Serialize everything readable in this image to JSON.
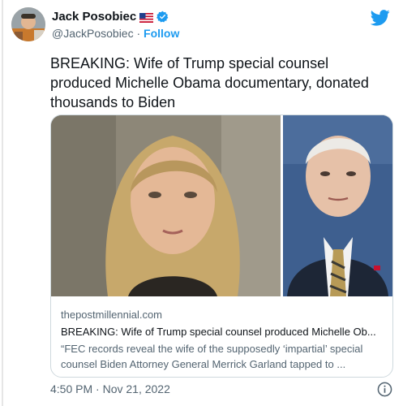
{
  "author": {
    "name": "Jack Posobiec",
    "handle": "@JackPosobiec",
    "separator": "·",
    "follow_label": "Follow"
  },
  "tweet": {
    "text": "BREAKING: Wife of Trump special counsel produced Michelle Obama documentary, donated thousands to Biden",
    "timestamp": "4:50 PM · Nov 21, 2022"
  },
  "card": {
    "domain": "thepostmillennial.com",
    "title": "BREAKING: Wife of Trump special counsel produced Michelle Ob...",
    "description": "“FEC records reveal the wife of the supposedly ‘impartial’ special counsel Biden Attorney General Merrick Garland tapped to ..."
  },
  "icons": {
    "twitter": "twitter-bird-icon",
    "verified": "verified-badge-icon",
    "flag": "us-flag-icon",
    "info": "info-icon"
  },
  "colors": {
    "accent": "#1d9bf0",
    "text": "#0f1419",
    "muted": "#536471",
    "border": "#cfd9de"
  }
}
